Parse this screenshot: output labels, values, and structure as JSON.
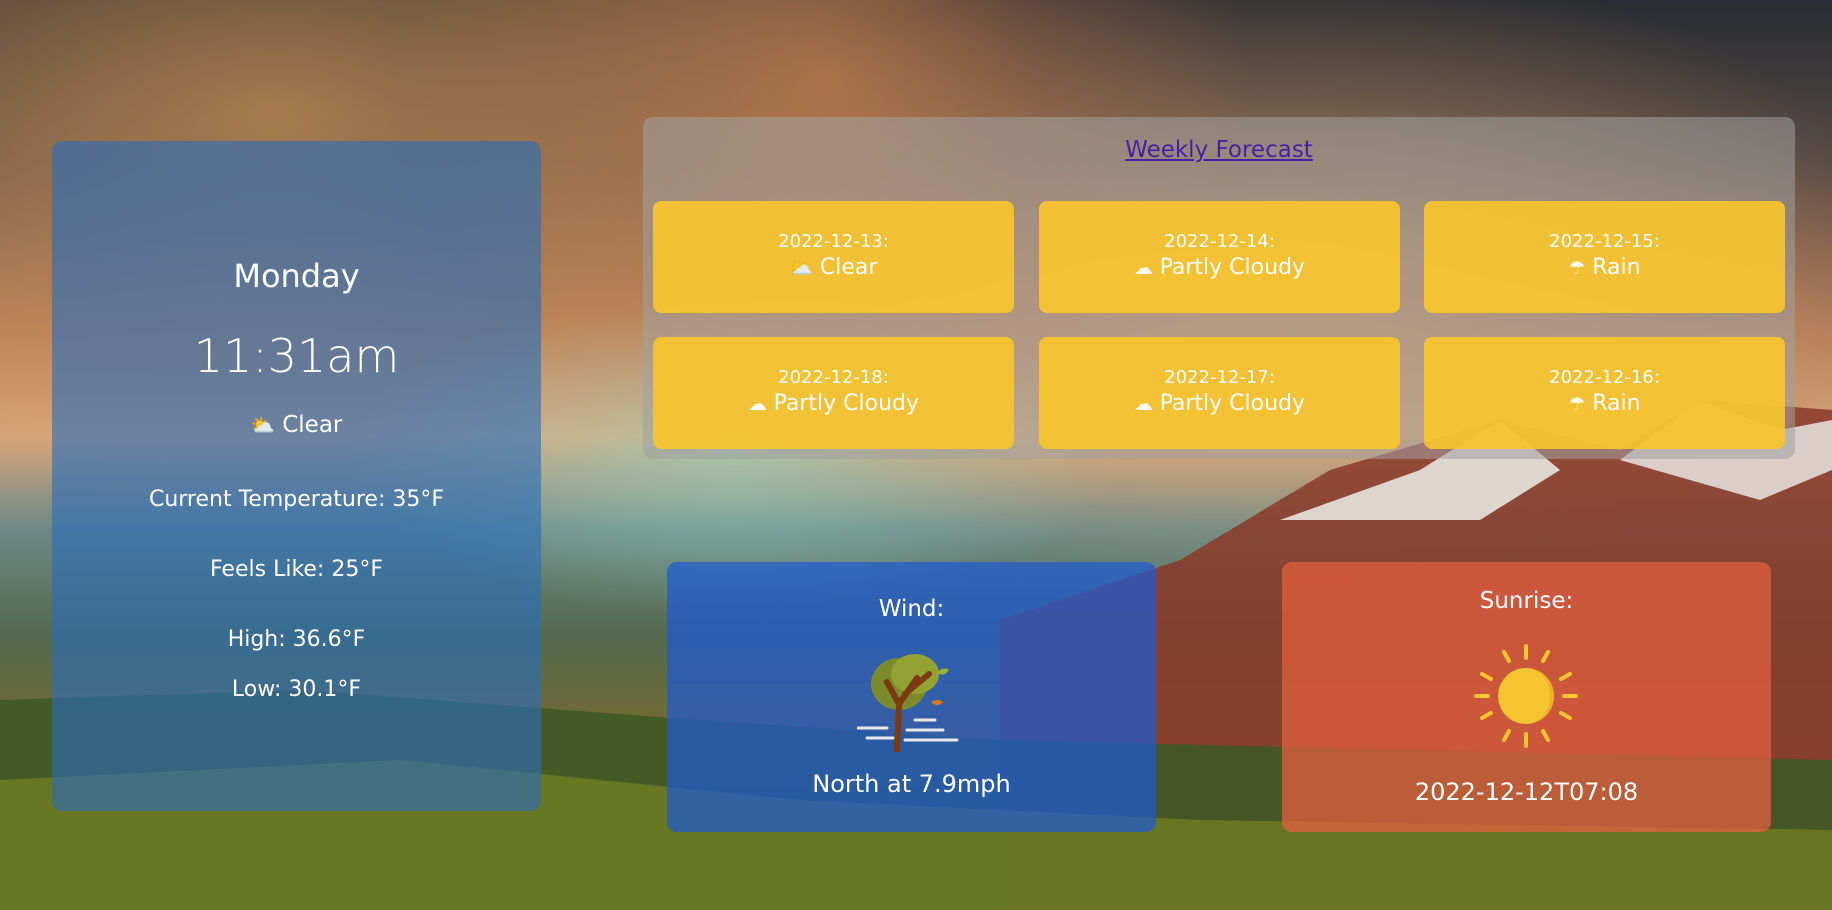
{
  "current": {
    "day": "Monday",
    "time": "11:31am",
    "condition_icon": "sun-behind-cloud-icon",
    "condition": "Clear",
    "temperature": "Current Temperature: 35°F",
    "feels_like": "Feels Like: 25°F",
    "high": "High: 36.6°F",
    "low": "Low: 30.1°F"
  },
  "weekly": {
    "title": "Weekly Forecast",
    "days": [
      {
        "date": "2022-12-13:",
        "icon": "sun-behind-cloud-icon",
        "glyph": "⛅",
        "condition": "Clear"
      },
      {
        "date": "2022-12-14:",
        "icon": "cloud-icon",
        "glyph": "☁",
        "condition": "Partly Cloudy"
      },
      {
        "date": "2022-12-15:",
        "icon": "rain-cloud-icon",
        "glyph": "☂",
        "condition": "Rain"
      },
      {
        "date": "2022-12-18:",
        "icon": "cloud-icon",
        "glyph": "☁",
        "condition": "Partly Cloudy"
      },
      {
        "date": "2022-12-17:",
        "icon": "cloud-icon",
        "glyph": "☁",
        "condition": "Partly Cloudy"
      },
      {
        "date": "2022-12-16:",
        "icon": "rain-cloud-icon",
        "glyph": "☂",
        "condition": "Rain"
      }
    ]
  },
  "wind": {
    "label": "Wind:",
    "icon": "wind-tree-icon",
    "value": "North at 7.9mph"
  },
  "sunrise": {
    "label": "Sunrise:",
    "icon": "sun-icon",
    "value": "2022-12-12T07:08"
  }
}
